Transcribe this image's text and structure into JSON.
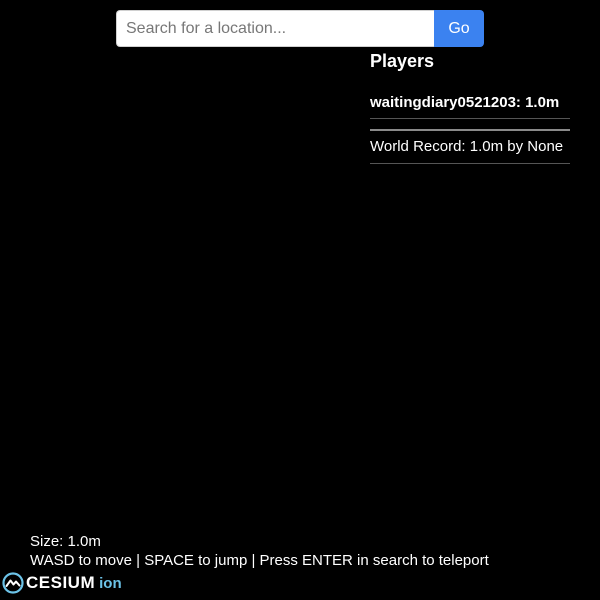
{
  "search": {
    "placeholder": "Search for a location...",
    "value": "",
    "go_label": "Go"
  },
  "players_panel": {
    "title": "Players",
    "players": [
      {
        "entry": "waitingdiary0521203: 1.0m"
      }
    ],
    "world_record": "World Record: 1.0m by None"
  },
  "hud": {
    "size": "Size: 1.0m",
    "controls": "WASD to move | SPACE to jump | Press ENTER in search to teleport"
  },
  "logo": {
    "brand": "CESIUM",
    "product": "ion",
    "icon": "cesium-globe-icon",
    "product_color": "#6cc3e8"
  },
  "colors": {
    "background": "#000000",
    "accent": "#3b82f0"
  }
}
